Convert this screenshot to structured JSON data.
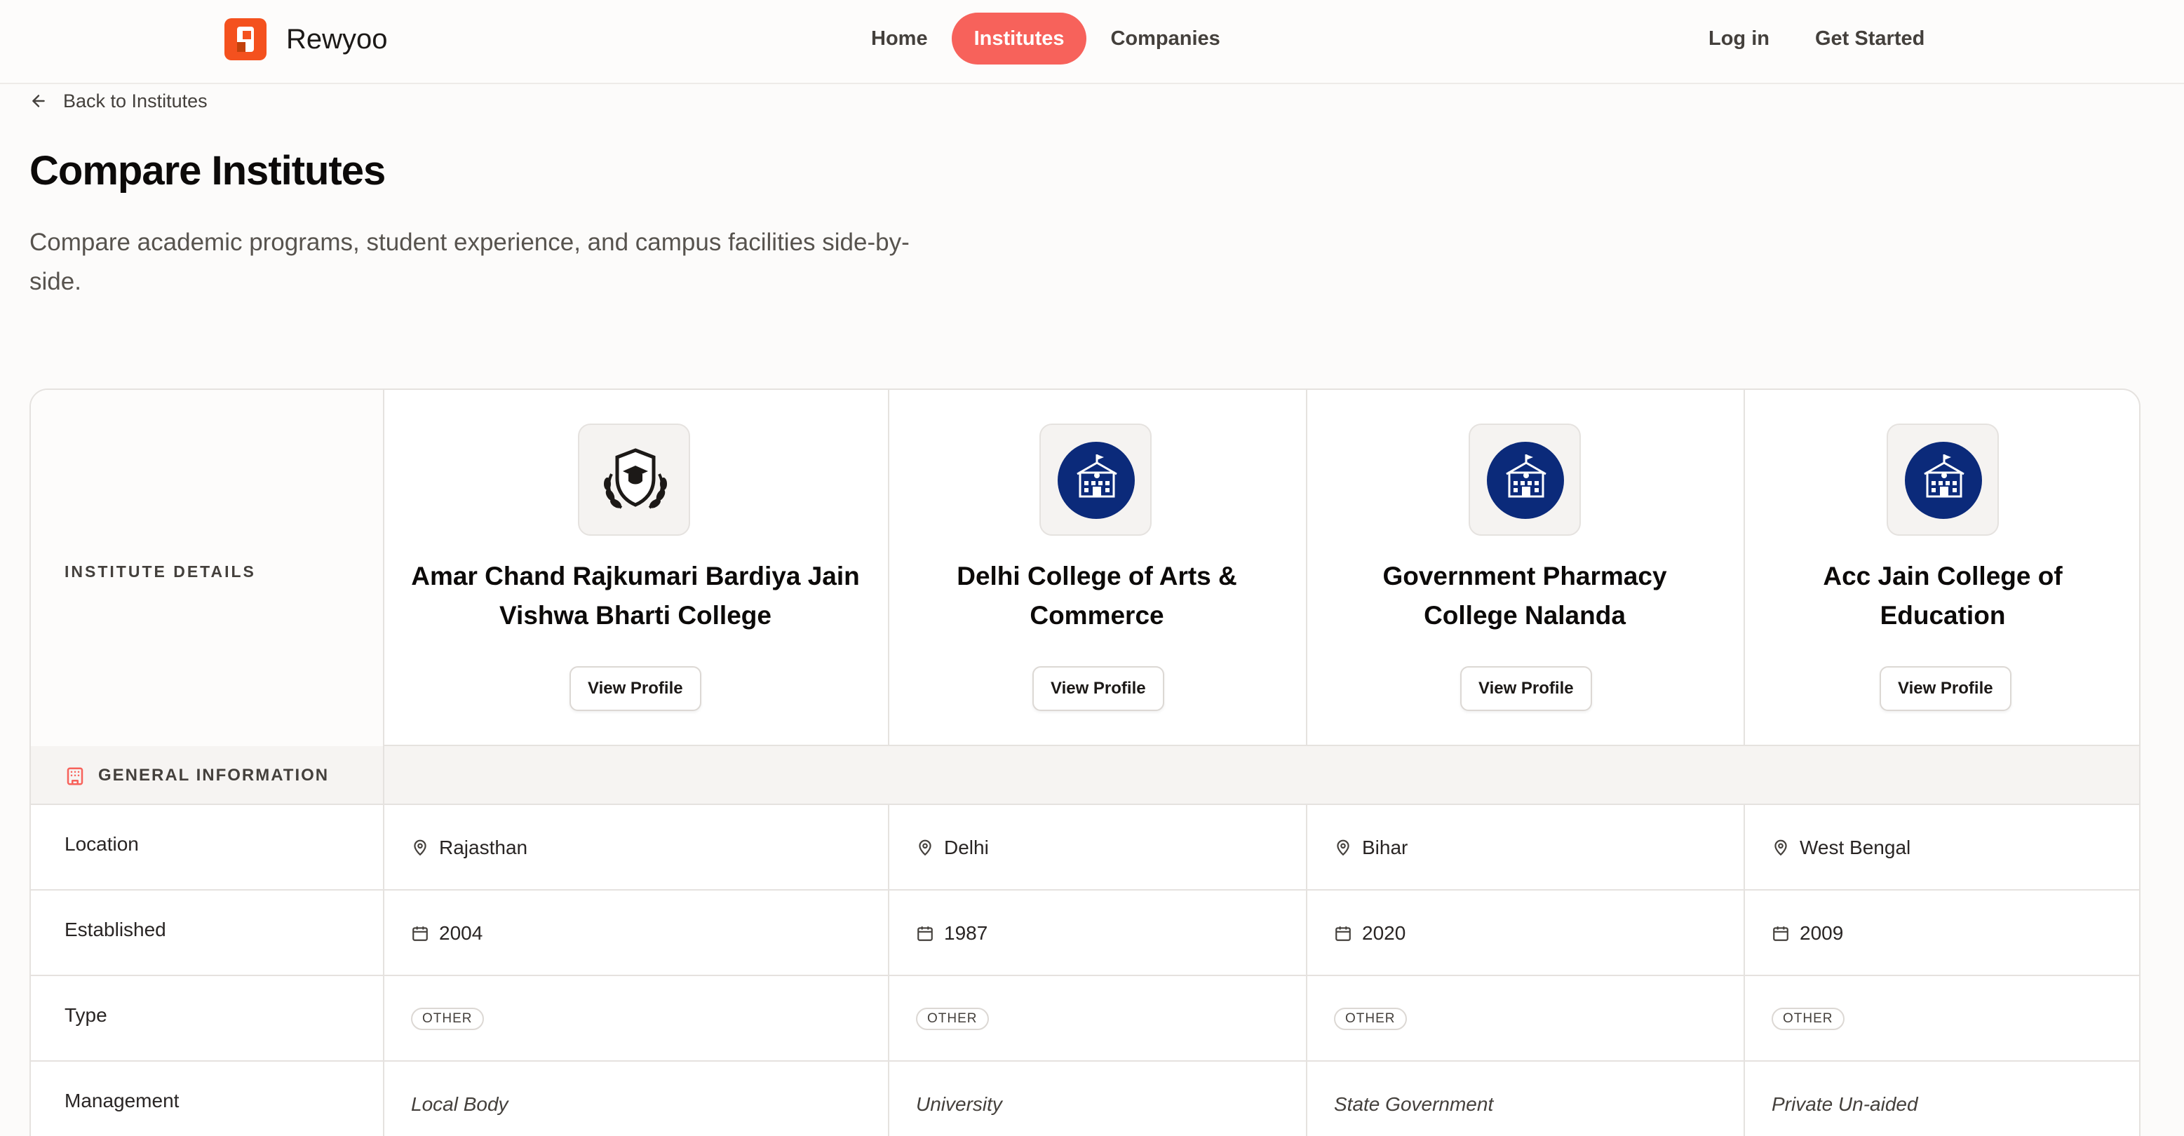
{
  "header": {
    "brand": "Rewyoo",
    "nav": [
      {
        "label": "Home",
        "active": false
      },
      {
        "label": "Institutes",
        "active": true
      },
      {
        "label": "Companies",
        "active": false
      }
    ],
    "login": "Log in",
    "get_started": "Get Started"
  },
  "back_link": "Back to Institutes",
  "title": "Compare Institutes",
  "subtitle": "Compare academic programs, student experience, and campus facilities side-by-side.",
  "table": {
    "details_header": "INSTITUTE DETAILS",
    "view_profile": "View Profile",
    "institutes": [
      {
        "name": "Amar Chand Rajkumari Bardiya Jain Vishwa Bharti College",
        "logo": "shield-laurel-icon",
        "location": "Rajasthan",
        "established": "2004",
        "type": "OTHER",
        "management": "Local Body"
      },
      {
        "name": "Delhi College of Arts & Commerce",
        "logo": "college-building-icon",
        "location": "Delhi",
        "established": "1987",
        "type": "OTHER",
        "management": "University"
      },
      {
        "name": "Government Pharmacy College Nalanda",
        "logo": "college-building-icon",
        "location": "Bihar",
        "established": "2020",
        "type": "OTHER",
        "management": "State Government"
      },
      {
        "name": "Acc Jain College of Education",
        "logo": "college-building-icon",
        "location": "West Bengal",
        "established": "2009",
        "type": "OTHER",
        "management": "Private Un-aided"
      }
    ],
    "section_general": "GENERAL INFORMATION",
    "rows": {
      "location": "Location",
      "established": "Established",
      "type": "Type",
      "management": "Management"
    }
  },
  "colors": {
    "accent": "#f7625b",
    "brand_orange": "#f4511e",
    "logo_navy": "#0b2a7a"
  }
}
